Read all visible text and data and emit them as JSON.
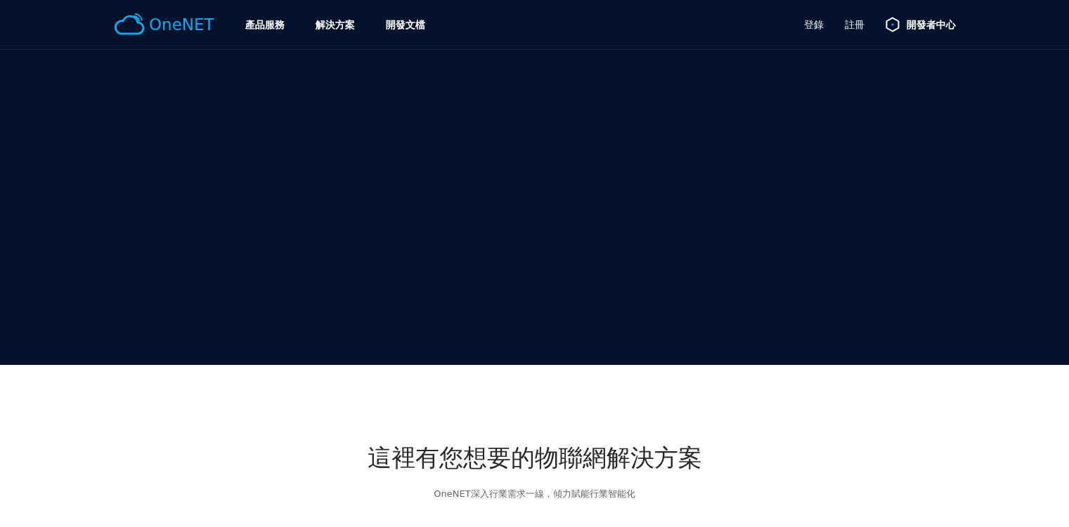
{
  "header": {
    "logo": "OneNET",
    "nav": [
      "產品服務",
      "解決方案",
      "開發文檔"
    ],
    "account_links": [
      "登錄",
      "註冊"
    ],
    "developer_center": "開發者中心"
  },
  "section": {
    "title": "這裡有您想要的物聯網解決方案",
    "subtitle": "OneNET深入行業需求一線，傾力賦能行業智能化"
  }
}
